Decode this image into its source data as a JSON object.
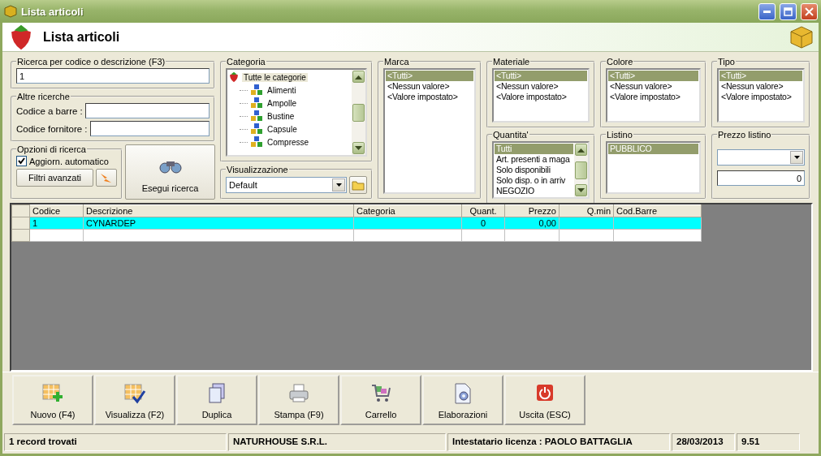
{
  "window": {
    "title": "Lista articoli"
  },
  "header": {
    "title": "Lista articoli"
  },
  "search": {
    "legend": "Ricerca per codice o descrizione (F3)",
    "value": "1"
  },
  "other_searches": {
    "legend": "Altre ricerche",
    "fields": [
      {
        "label": "Codice a barre :"
      },
      {
        "label": "Codice fornitore :"
      }
    ]
  },
  "options": {
    "legend": "Opzioni di ricerca",
    "auto_update": {
      "label": "Aggiorn. automatico",
      "checked": true
    },
    "advanced_button": "Filtri avanzati"
  },
  "search_button": "Esegui ricerca",
  "category": {
    "legend": "Categoria",
    "root": {
      "label": "Tutte le categorie",
      "selected": true,
      "children": [
        {
          "label": "Alimenti",
          "selected": false
        },
        {
          "label": "Ampolle",
          "selected": false
        },
        {
          "label": "Bustine",
          "selected": false
        },
        {
          "label": "Capsule",
          "selected": false
        },
        {
          "label": "Compresse",
          "selected": false
        }
      ]
    }
  },
  "view": {
    "legend": "Visualizzazione",
    "value": "Default"
  },
  "filters": [
    {
      "legend": "Marca",
      "scroll": false,
      "items": [
        {
          "label": "<Tutti>",
          "selected": true
        },
        {
          "label": "<Nessun valore>",
          "selected": false
        },
        {
          "label": "<Valore impostato>",
          "selected": false
        }
      ]
    },
    {
      "legend": "Materiale",
      "scroll": false,
      "items": [
        {
          "label": "<Tutti>",
          "selected": true
        },
        {
          "label": "<Nessun valore>",
          "selected": false
        },
        {
          "label": "<Valore impostato>",
          "selected": false
        }
      ]
    },
    {
      "legend": "Colore",
      "scroll": false,
      "items": [
        {
          "label": "<Tutti>",
          "selected": true
        },
        {
          "label": "<Nessun valore>",
          "selected": false
        },
        {
          "label": "<Valore impostato>",
          "selected": false
        }
      ]
    },
    {
      "legend": "Tipo",
      "scroll": false,
      "items": [
        {
          "label": "<Tutti>",
          "selected": true
        },
        {
          "label": "<Nessun valore>",
          "selected": false
        },
        {
          "label": "<Valore impostato>",
          "selected": false
        }
      ]
    },
    {
      "legend": "Quantita'",
      "scroll": true,
      "items": [
        {
          "label": "Tutti",
          "selected": true
        },
        {
          "label": "Art. presenti a maga",
          "selected": false
        },
        {
          "label": "Solo disponibili",
          "selected": false
        },
        {
          "label": "Solo disp. o in arriv",
          "selected": false
        },
        {
          "label": "NEGOZIO",
          "selected": false
        }
      ]
    },
    {
      "legend": "Listino",
      "scroll": false,
      "items": [
        {
          "label": "PUBBLICO",
          "selected": true
        }
      ]
    }
  ],
  "price": {
    "legend": "Prezzo listino",
    "value": "0"
  },
  "table": {
    "columns": [
      "Codice",
      "Descrizione",
      "Categoria",
      "Quant.",
      "Prezzo",
      "Q.min",
      "Cod.Barre"
    ],
    "rows": [
      {
        "selected": true,
        "cells": [
          "1",
          "CYNARDEP",
          null,
          "0",
          "0,00",
          null,
          null
        ]
      },
      {
        "selected": false
      }
    ]
  },
  "toolbar": [
    {
      "kind": "new",
      "label": "Nuovo (F4)"
    },
    {
      "kind": "view",
      "label": "Visualizza (F2)"
    },
    {
      "kind": "duplicate",
      "label": "Duplica"
    },
    {
      "kind": "print",
      "label": "Stampa (F9)"
    },
    {
      "kind": "cart",
      "label": "Carrello"
    },
    {
      "kind": "process",
      "label": "Elaborazioni"
    },
    {
      "kind": "exit",
      "label": "Uscita (ESC)"
    }
  ],
  "status_bar": [
    "1 record trovati",
    "NATURHOUSE S.R.L.",
    "Intestatario licenza : PAOLO BATTAGLIA",
    "28/03/2013",
    "9.51"
  ]
}
